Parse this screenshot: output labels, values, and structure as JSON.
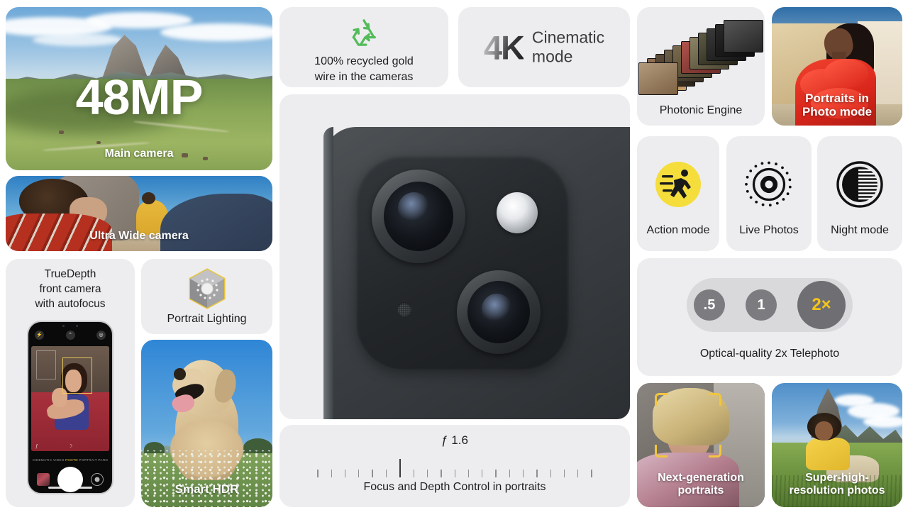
{
  "page": {
    "title": "iPhone camera features grid",
    "background": "#ffffff",
    "tile_background": "#ededef",
    "accent_yellow": "#f5c518",
    "text_color": "#1d1d1f"
  },
  "tiles": {
    "main_camera": {
      "headline": "48MP",
      "caption": "Main camera",
      "image_alt": "Alpine mountain meadow landscape"
    },
    "ultra_wide": {
      "caption": "Ultra Wide camera",
      "image_alt": "Beach scene with person in red patterned clothing"
    },
    "truedepth": {
      "title_line1": "TrueDepth",
      "title_line2": "front camera",
      "title_line3": "with autofocus",
      "phone_ui": {
        "modes": [
          "CINEMATIC",
          "VIDEO",
          "PHOTO",
          "PORTRAIT",
          "PANO"
        ],
        "active_mode": "PHOTO",
        "shutter_label": "shutter-button",
        "flip_label": "flip-camera-button"
      }
    },
    "portrait_lighting": {
      "caption": "Portrait Lighting",
      "icon": "lighting-cube-icon"
    },
    "smart_hdr": {
      "caption": "Smart HDR",
      "image_alt": "Golden retriever in a field of white flowers"
    },
    "recycled_gold": {
      "line1": "100% recycled gold",
      "line2": "wire in the cameras",
      "icon": "recycle-icon",
      "icon_color": "#4caf50"
    },
    "cinematic_4k": {
      "big": "4K",
      "sub_line1": "Cinematic",
      "sub_line2": "mode"
    },
    "camera_module": {
      "image_alt": "Close-up of dual camera module on dark iPhone",
      "parts": [
        "main-lens",
        "telephoto-lens",
        "flash",
        "microphone"
      ]
    },
    "focus_depth": {
      "aperture": "ƒ 1.6",
      "caption": "Focus and Depth Control in portraits",
      "tick_count": 21,
      "center_tick_index": 10
    },
    "photonic_engine": {
      "caption": "Photonic Engine",
      "image_alt": "Stack of photo frames fanning out diagonally"
    },
    "portraits_photo_mode": {
      "caption_line1": "Portraits in",
      "caption_line2": "Photo mode",
      "image_alt": "Woman in red ruffled dress against sandstone wall"
    },
    "action_mode": {
      "caption": "Action mode",
      "icon": "running-person-icon",
      "icon_bg": "#f5dd3c"
    },
    "live_photos": {
      "caption": "Live Photos",
      "icon": "live-photos-rings-icon"
    },
    "night_mode": {
      "caption": "Night mode",
      "icon": "crescent-moon-icon"
    },
    "telephoto": {
      "caption": "Optical-quality 2x Telephoto",
      "zoom_options": [
        {
          "label": ".5",
          "selected": false
        },
        {
          "label": "1",
          "selected": false
        },
        {
          "label": "2×",
          "selected": true
        }
      ]
    },
    "next_generation_portraits": {
      "caption_line1": "Next-generation",
      "caption_line2": "portraits",
      "image_alt": "Blond person with yellow focus brackets"
    },
    "super_high_resolution": {
      "caption_line1": "Super-high-",
      "caption_line2": "resolution photos",
      "image_alt": "Person in yellow sitting on alpine grass slope"
    }
  }
}
